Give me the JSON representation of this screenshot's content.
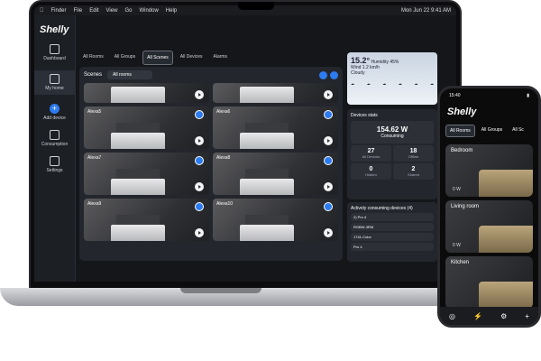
{
  "menubar": {
    "apple": "",
    "items": [
      "Finder",
      "File",
      "Edit",
      "View",
      "Go",
      "Window",
      "Help"
    ],
    "clock": "Mon Jun 22  9:41 AM"
  },
  "app": {
    "logo": "Shelly"
  },
  "sidebar": {
    "items": [
      {
        "label": "Dashboard"
      },
      {
        "label": "My home"
      },
      {
        "label": "Add device"
      },
      {
        "label": "Consumption"
      },
      {
        "label": "Settings"
      }
    ]
  },
  "tabs": [
    {
      "label": "All Rooms"
    },
    {
      "label": "All Groups"
    },
    {
      "label": "All Scenes"
    },
    {
      "label": "All Devices"
    },
    {
      "label": "Alarms"
    }
  ],
  "scenes": {
    "title": "Scenes",
    "room_select": "All rooms",
    "cards": [
      {
        "label": ""
      },
      {
        "label": ""
      },
      {
        "label": "Alexa5"
      },
      {
        "label": "Alexa6"
      },
      {
        "label": "Alexa7"
      },
      {
        "label": "Alexa8"
      },
      {
        "label": "Alexa9"
      },
      {
        "label": "Alexa10"
      }
    ]
  },
  "weather": {
    "temp": "15.2°",
    "humidity": "Humidity 45%",
    "wind": "Wind 1.2 km/h",
    "condition": "Cloudy"
  },
  "stats": {
    "title": "Devices stats",
    "power": "154.62 W",
    "power_label": "Consuming",
    "tiles": [
      {
        "value": "27",
        "label": "All Devices"
      },
      {
        "value": "18",
        "label": "Offline"
      },
      {
        "value": "0",
        "label": "Hidden"
      },
      {
        "value": "2",
        "label": "Shared"
      }
    ]
  },
  "active_devices": {
    "title": "Actively consuming devices (4)",
    "items": [
      "2) Pro 4",
      "RGBW-3RM",
      "1741-Color",
      "Pro 4"
    ]
  },
  "phone": {
    "time": "15:40",
    "logo": "Shelly",
    "tabs": [
      "All Rooms",
      "All Groups",
      "All Sc"
    ],
    "rooms": [
      {
        "name": "Bedroom",
        "power": "0 W"
      },
      {
        "name": "Living room",
        "power": "0 W"
      },
      {
        "name": "Kitchen",
        "power": ""
      }
    ]
  }
}
